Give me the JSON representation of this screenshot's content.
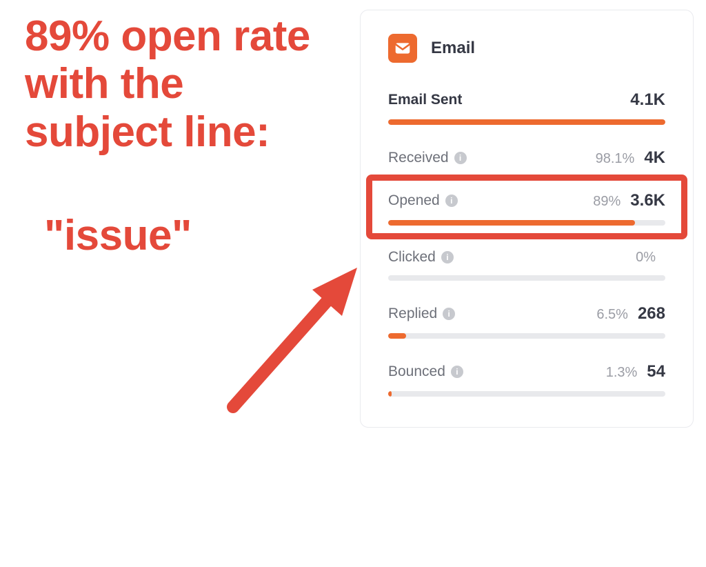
{
  "annotation": {
    "headline": "89% open rate with the subject line:",
    "subject": "\"issue\""
  },
  "card": {
    "title": "Email"
  },
  "metrics": {
    "sent": {
      "label": "Email Sent",
      "pct": "",
      "value": "4.1K",
      "fill": 100,
      "strong": true,
      "info": false
    },
    "received": {
      "label": "Received",
      "pct": "98.1%",
      "value": "4K",
      "fill": 0,
      "strong": false,
      "info": true
    },
    "opened": {
      "label": "Opened",
      "pct": "89%",
      "value": "3.6K",
      "fill": 89,
      "strong": false,
      "info": true
    },
    "clicked": {
      "label": "Clicked",
      "pct": "0%",
      "value": "",
      "fill": 0,
      "strong": false,
      "info": true
    },
    "replied": {
      "label": "Replied",
      "pct": "6.5%",
      "value": "268",
      "fill": 6.5,
      "strong": false,
      "info": true
    },
    "bounced": {
      "label": "Bounced",
      "pct": "1.3%",
      "value": "54",
      "fill": 1.3,
      "strong": false,
      "info": true
    }
  },
  "colors": {
    "accent": "#ed6a2f",
    "highlight": "#e4493a"
  },
  "chart_data": {
    "type": "bar",
    "title": "Email",
    "series": [
      {
        "name": "Email Sent",
        "value": 4100,
        "display": "4.1K",
        "pct": 100
      },
      {
        "name": "Received",
        "value": 4000,
        "display": "4K",
        "pct": 98.1
      },
      {
        "name": "Opened",
        "value": 3600,
        "display": "3.6K",
        "pct": 89
      },
      {
        "name": "Clicked",
        "value": 0,
        "display": "",
        "pct": 0
      },
      {
        "name": "Replied",
        "value": 268,
        "display": "268",
        "pct": 6.5
      },
      {
        "name": "Bounced",
        "value": 54,
        "display": "54",
        "pct": 1.3
      }
    ],
    "xlabel": "",
    "ylabel": "",
    "ylim": [
      0,
      100
    ]
  }
}
